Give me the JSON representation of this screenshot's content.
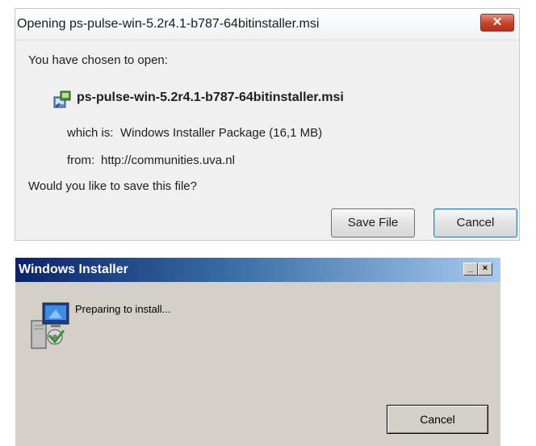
{
  "open_dialog": {
    "title": "Opening ps-pulse-win-5.2r4.1-b787-64bitinstaller.msi",
    "close_glyph": "✕",
    "intro": "You have chosen to open:",
    "file_icon": "msi-package-icon",
    "filename": "ps-pulse-win-5.2r4.1-b787-64bitinstaller.msi",
    "which_is_label": "which is:",
    "which_is_value": "Windows Installer Package (16,1 MB)",
    "from_label": "from:",
    "from_value": "http://communities.uva.nl",
    "question": "Would you like to save this file?",
    "save_button": "Save File",
    "cancel_button": "Cancel"
  },
  "installer_dialog": {
    "title": "Windows Installer",
    "minimize_glyph": "_",
    "close_glyph": "×",
    "icon": "installer-computer-icon",
    "status": "Preparing to install...",
    "cancel_button": "Cancel"
  }
}
